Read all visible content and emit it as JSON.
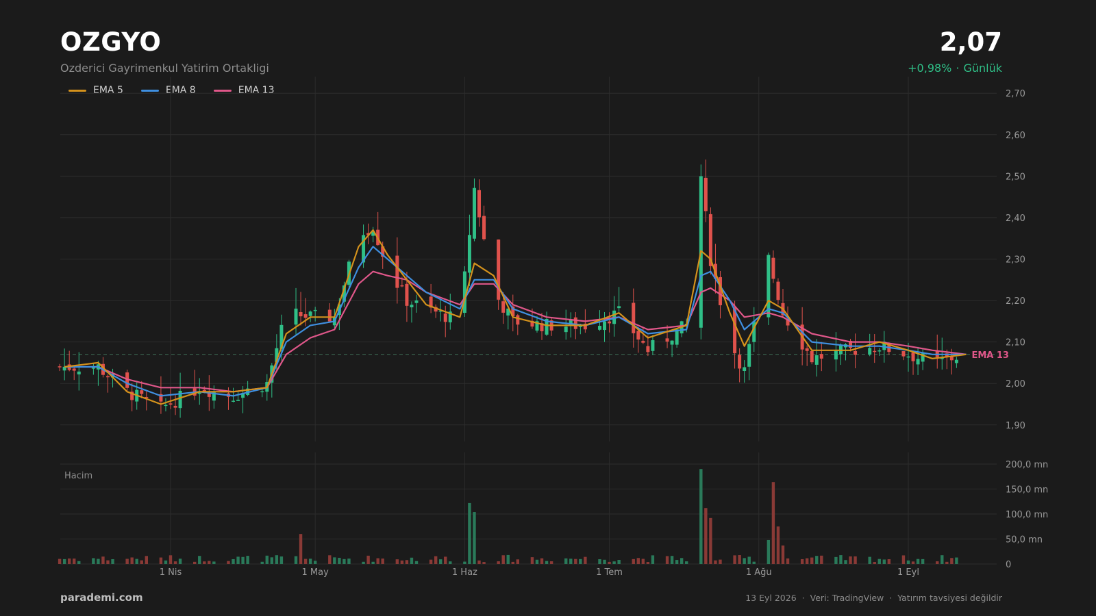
{
  "header": {
    "ticker": "OZGYO",
    "company": "Ozderici Gayrimenkul Yatirim Ortakligi",
    "price": "2,07",
    "change": "+0,98%",
    "period": "Günlük"
  },
  "footer": {
    "brand": "parademi.com",
    "date": "13 Eyl 2026",
    "source": "Veri: TradingView",
    "disclaimer": "Yatırım tavsiyesi değildir"
  },
  "colors": {
    "background": "#1b1b1b",
    "up": "#2fbf87",
    "down": "#e0524c",
    "volume_up": "#2a7a5a",
    "volume_down": "#8a3a36",
    "grid": "#2c2c2c",
    "ema5": "#d4921c",
    "ema8": "#3f8fe0",
    "ema13": "#e0578a"
  },
  "chart_data": [
    {
      "type": "candlestick",
      "legend": [
        "EMA 5",
        "EMA 8",
        "EMA 13"
      ],
      "legend_placement": "top-left",
      "ylim": [
        1.86,
        2.74
      ],
      "yticks": [
        1.9,
        2.0,
        2.1,
        2.2,
        2.3,
        2.4,
        2.5,
        2.6,
        2.7
      ],
      "ytick_labels": [
        "1,90",
        "2,00",
        "2,10",
        "2,20",
        "2,30",
        "2,40",
        "2,50",
        "2,60",
        "2,70"
      ],
      "xticks": [
        "2026-04-01",
        "2026-05-01",
        "2026-06-01",
        "2026-07-01",
        "2026-08-01",
        "2026-09-01"
      ],
      "xtick_labels": [
        "1 Nis",
        "1 May",
        "1 Haz",
        "1 Tem",
        "1 Ağu",
        "1 Eyl"
      ],
      "date_range": [
        "2026-03-09",
        "2026-09-13"
      ],
      "last_close": 2.07,
      "last_label": "EMA 13",
      "grid": true,
      "anchors": [
        {
          "date": "2026-03-10",
          "close": 2.04,
          "ema5": 2.04,
          "ema8": 2.04,
          "ema13": 2.04
        },
        {
          "date": "2026-03-17",
          "close": 2.04,
          "ema5": 2.05,
          "ema8": 2.04,
          "ema13": 2.04
        },
        {
          "date": "2026-03-23",
          "close": 1.98,
          "ema5": 1.98,
          "ema8": 2.0,
          "ema13": 2.01
        },
        {
          "date": "2026-03-30",
          "close": 1.94,
          "ema5": 1.95,
          "ema8": 1.97,
          "ema13": 1.99
        },
        {
          "date": "2026-04-07",
          "close": 1.99,
          "ema5": 1.98,
          "ema8": 1.98,
          "ema13": 1.99
        },
        {
          "date": "2026-04-14",
          "close": 1.97,
          "ema5": 1.98,
          "ema8": 1.97,
          "ema13": 1.98
        },
        {
          "date": "2026-04-21",
          "close": 2.0,
          "ema5": 1.99,
          "ema8": 1.99,
          "ema13": 1.99
        },
        {
          "date": "2026-04-25",
          "close": 2.17,
          "ema5": 2.12,
          "ema8": 2.1,
          "ema13": 2.07
        },
        {
          "date": "2026-04-30",
          "close": 2.16,
          "ema5": 2.16,
          "ema8": 2.14,
          "ema13": 2.11
        },
        {
          "date": "2026-05-05",
          "close": 2.16,
          "ema5": 2.16,
          "ema8": 2.15,
          "ema13": 2.13
        },
        {
          "date": "2026-05-10",
          "close": 2.36,
          "ema5": 2.33,
          "ema8": 2.28,
          "ema13": 2.24
        },
        {
          "date": "2026-05-13",
          "close": 2.38,
          "ema5": 2.37,
          "ema8": 2.33,
          "ema13": 2.27
        },
        {
          "date": "2026-05-16",
          "close": 2.28,
          "ema5": 2.31,
          "ema8": 2.3,
          "ema13": 2.26
        },
        {
          "date": "2026-05-20",
          "close": 2.2,
          "ema5": 2.25,
          "ema8": 2.26,
          "ema13": 2.25
        },
        {
          "date": "2026-05-24",
          "close": 2.18,
          "ema5": 2.19,
          "ema8": 2.22,
          "ema13": 2.22
        },
        {
          "date": "2026-05-31",
          "close": 2.15,
          "ema5": 2.16,
          "ema8": 2.18,
          "ema13": 2.19
        },
        {
          "date": "2026-06-03",
          "close": 2.47,
          "ema5": 2.29,
          "ema8": 2.25,
          "ema13": 2.24
        },
        {
          "date": "2026-06-07",
          "close": 2.22,
          "ema5": 2.26,
          "ema8": 2.25,
          "ema13": 2.24
        },
        {
          "date": "2026-06-11",
          "close": 2.15,
          "ema5": 2.16,
          "ema8": 2.18,
          "ema13": 2.19
        },
        {
          "date": "2026-06-18",
          "close": 2.14,
          "ema5": 2.14,
          "ema8": 2.15,
          "ema13": 2.16
        },
        {
          "date": "2026-06-26",
          "close": 2.14,
          "ema5": 2.14,
          "ema8": 2.14,
          "ema13": 2.15
        },
        {
          "date": "2026-07-03",
          "close": 2.17,
          "ema5": 2.17,
          "ema8": 2.16,
          "ema13": 2.16
        },
        {
          "date": "2026-07-09",
          "close": 2.08,
          "ema5": 2.11,
          "ema8": 2.12,
          "ema13": 2.13
        },
        {
          "date": "2026-07-17",
          "close": 2.14,
          "ema5": 2.14,
          "ema8": 2.13,
          "ema13": 2.14
        },
        {
          "date": "2026-07-20",
          "close": 2.5,
          "ema5": 2.32,
          "ema8": 2.26,
          "ema13": 2.22
        },
        {
          "date": "2026-07-22",
          "close": 2.3,
          "ema5": 2.3,
          "ema8": 2.27,
          "ema13": 2.23
        },
        {
          "date": "2026-07-26",
          "close": 2.1,
          "ema5": 2.17,
          "ema8": 2.2,
          "ema13": 2.2
        },
        {
          "date": "2026-07-29",
          "close": 2.03,
          "ema5": 2.09,
          "ema8": 2.13,
          "ema13": 2.16
        },
        {
          "date": "2026-08-03",
          "close": 2.3,
          "ema5": 2.2,
          "ema8": 2.18,
          "ema13": 2.17
        },
        {
          "date": "2026-08-06",
          "close": 2.17,
          "ema5": 2.18,
          "ema8": 2.17,
          "ema13": 2.16
        },
        {
          "date": "2026-08-12",
          "close": 2.06,
          "ema5": 2.08,
          "ema8": 2.1,
          "ema13": 2.12
        },
        {
          "date": "2026-08-20",
          "close": 2.08,
          "ema5": 2.08,
          "ema8": 2.09,
          "ema13": 2.1
        },
        {
          "date": "2026-08-26",
          "close": 2.09,
          "ema5": 2.1,
          "ema8": 2.09,
          "ema13": 2.1
        },
        {
          "date": "2026-09-01",
          "close": 2.07,
          "ema5": 2.08,
          "ema8": 2.08,
          "ema13": 2.09
        },
        {
          "date": "2026-09-06",
          "close": 2.05,
          "ema5": 2.06,
          "ema8": 2.07,
          "ema13": 2.08
        },
        {
          "date": "2026-09-13",
          "close": 2.07,
          "ema5": 2.07,
          "ema8": 2.07,
          "ema13": 2.07
        }
      ]
    },
    {
      "type": "bar",
      "title": "Hacim",
      "ylim": [
        0,
        215
      ],
      "yticks": [
        0,
        50,
        100,
        150,
        200
      ],
      "ytick_labels": [
        "0",
        "50,0 mn",
        "100,0 mn",
        "150,0 mn",
        "200,0 mn"
      ],
      "spikes": [
        {
          "date": "2026-04-28",
          "value": 60
        },
        {
          "date": "2026-06-02",
          "value": 122
        },
        {
          "date": "2026-06-03",
          "value": 104
        },
        {
          "date": "2026-06-06",
          "value": 102
        },
        {
          "date": "2026-07-04",
          "value": 44
        },
        {
          "date": "2026-07-19",
          "value": 105
        },
        {
          "date": "2026-07-20",
          "value": 190
        },
        {
          "date": "2026-07-21",
          "value": 112
        },
        {
          "date": "2026-07-22",
          "value": 92
        },
        {
          "date": "2026-07-26",
          "value": 52
        },
        {
          "date": "2026-08-03",
          "value": 48
        },
        {
          "date": "2026-08-04",
          "value": 164
        },
        {
          "date": "2026-08-05",
          "value": 75
        },
        {
          "date": "2026-08-06",
          "value": 37
        }
      ]
    }
  ]
}
